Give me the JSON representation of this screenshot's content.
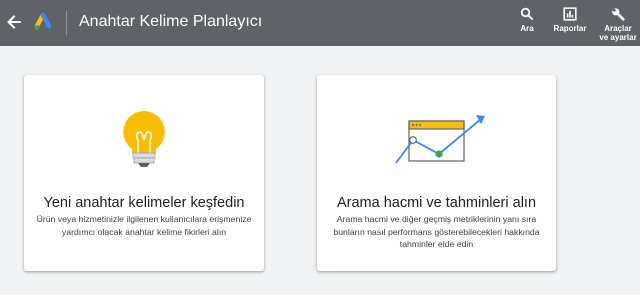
{
  "header": {
    "title": "Anahtar Kelime Planlayıcı",
    "tools": {
      "search": "Ara",
      "reports": "Raporlar",
      "settings_line1": "Araçlar",
      "settings_line2": "ve ayarlar"
    }
  },
  "cards": [
    {
      "title": "Yeni anahtar kelimeler keşfedin",
      "description": "Ürün veya hizmetinizle ilgilenen kullanıcılara erişmenize yardımcı olacak anahtar kelime fikirleri alın",
      "icon": "lightbulb-icon"
    },
    {
      "title": "Arama hacmi ve tahminleri alın",
      "description": "Arama hacmi ve diğer geçmiş metriklerinin yanı sıra bunların nasıl performans gösterebilecekleri hakkında tahminler elde edin",
      "icon": "forecast-chart-icon"
    }
  ],
  "colors": {
    "header_bg": "#5f6368",
    "page_bg": "#f1f3f4",
    "bulb_yellow": "#fbbc04",
    "trend_blue": "#4285f4",
    "point_green": "#34a853"
  }
}
